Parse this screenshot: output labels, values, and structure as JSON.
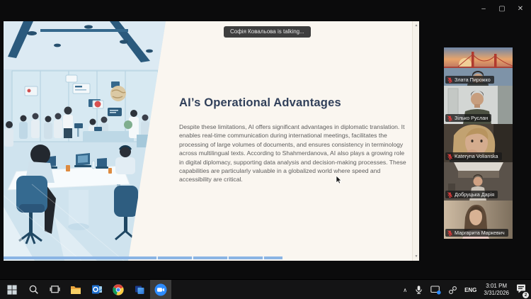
{
  "meeting": {
    "toast": "Софія Ковальова is talking...",
    "participants": [
      {
        "name": "Злата Пирожко",
        "muted": true
      },
      {
        "name": "Зілько Руслан",
        "muted": true
      },
      {
        "name": "Kateryna Volianska",
        "muted": true
      },
      {
        "name": "Добруцька Дарія",
        "muted": true
      },
      {
        "name": "Маргарита Маркевич",
        "muted": true
      }
    ]
  },
  "slide": {
    "title": "AI’s Operational Advantages",
    "body": "Despite these limitations, AI offers significant advantages in diplomatic translation. It enables real-time communication during international meetings, facilitates the processing of large volumes of documents, and ensures consistency in terminology across multilingual texts. According to Shahmerdanova, AI also plays a growing role in digital diplomacy, supporting data analysis and decision-making processes. These capabilities are particularly valuable in a globalized world where speed and accessibility are critical."
  },
  "icons": {
    "minimize": "–",
    "maximize": "▢",
    "close": "✕",
    "tray_expand": "∧",
    "scroll_up": "▲",
    "scroll_down": "▼"
  },
  "taskbar": {
    "apps": [
      {
        "name": "Start"
      },
      {
        "name": "Search"
      },
      {
        "name": "Task View"
      },
      {
        "name": "File Explorer"
      },
      {
        "name": "Outlook"
      },
      {
        "name": "Chrome"
      },
      {
        "name": "App"
      },
      {
        "name": "Zoom",
        "active": true
      }
    ],
    "tray": {
      "language": "ENG",
      "time": "3:01 PM",
      "date": "3/31/2026",
      "notification_count": "2"
    }
  },
  "colors": {
    "zoom_blue": "#2D8CFF",
    "muted_mic_red": "#E23B3B",
    "slide_background": "#FAF6F0",
    "slide_title": "#31405A",
    "taskbar": "#141415"
  }
}
